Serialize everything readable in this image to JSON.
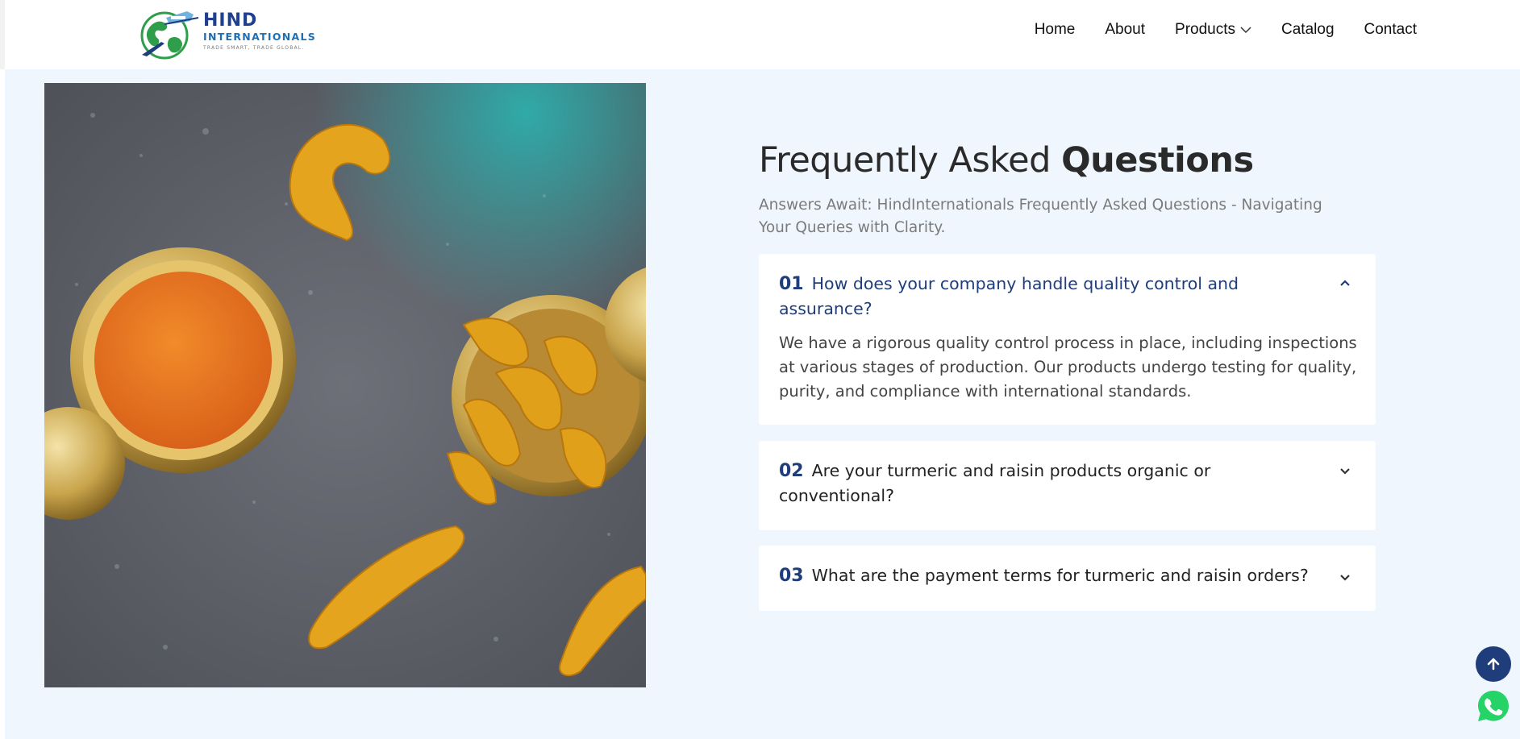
{
  "brand": {
    "name_line1": "HIND",
    "name_line2": "INTERNATIONALS",
    "tagline": "TRADE SMART, TRADE GLOBAL."
  },
  "nav": {
    "items": [
      {
        "label": "Home",
        "icon": null
      },
      {
        "label": "About",
        "icon": null
      },
      {
        "label": "Products",
        "icon": "chevron-down-icon"
      },
      {
        "label": "Catalog",
        "icon": null
      },
      {
        "label": "Contact",
        "icon": null
      }
    ]
  },
  "faq": {
    "title_light": "Frequently Asked ",
    "title_bold": "Questions",
    "subtitle": "Answers Await: HindInternationals Frequently Asked Questions - Navigating Your Queries with Clarity.",
    "items": [
      {
        "number": "01",
        "question": "How does your company handle quality control and assurance?",
        "answer": "We have a rigorous quality control process in place, including inspections at various stages of production. Our products undergo testing for quality, purity, and compliance with international standards.",
        "expanded": true,
        "icon": "chevron-up-icon"
      },
      {
        "number": "02",
        "question": "Are your turmeric and raisin products organic or conventional?",
        "expanded": false,
        "icon": "chevron-down-icon"
      },
      {
        "number": "03",
        "question": "What are the payment terms for turmeric and raisin orders?",
        "expanded": false,
        "icon": "chevron-down-icon"
      }
    ]
  },
  "colors": {
    "brand_navy": "#1f3d7a",
    "section_bg": "#eff6fd",
    "whatsapp_green": "#25d366"
  },
  "floating": {
    "scroll_top_icon": "arrow-up-icon",
    "whatsapp_icon": "whatsapp-icon"
  }
}
